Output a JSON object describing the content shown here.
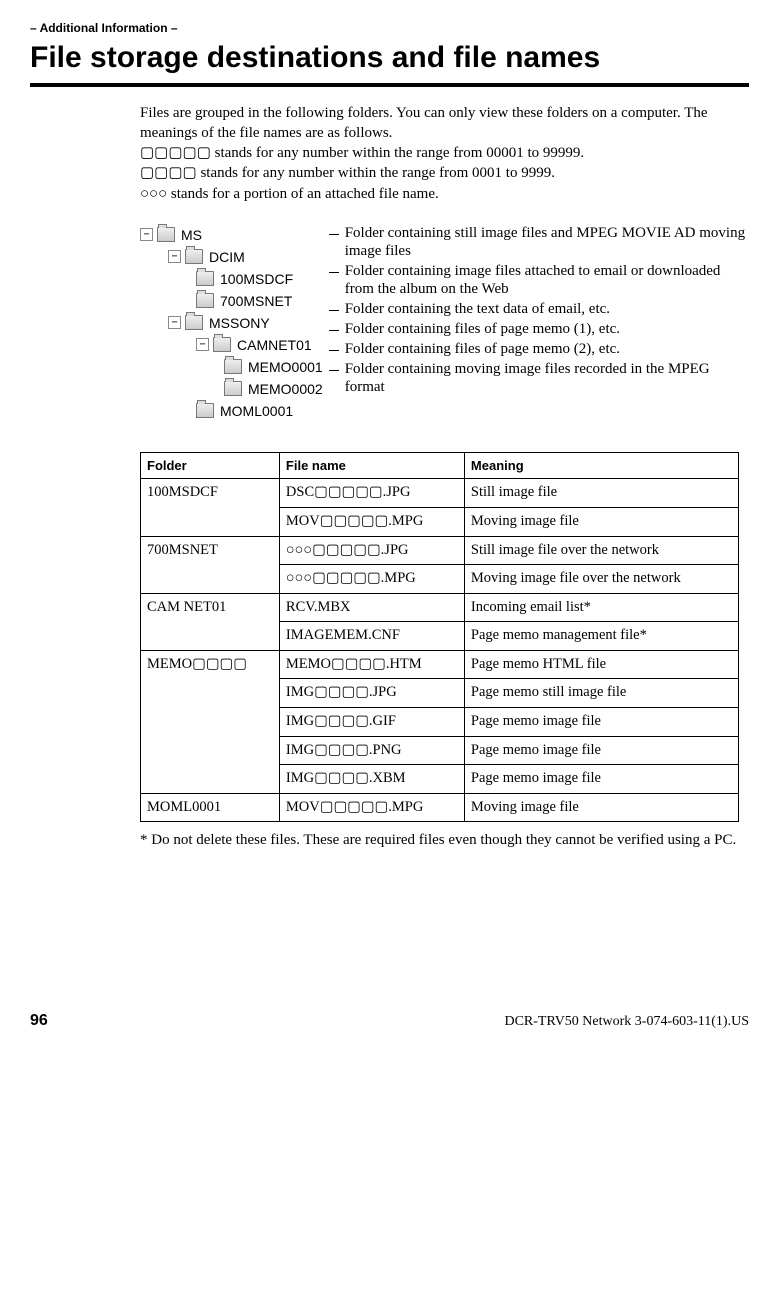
{
  "section_label": "– Additional Information –",
  "title": "File storage destinations and file names",
  "intro": {
    "l1": "Files are grouped in the following folders. You can only view these folders on a computer. The meanings of the file names are as follows.",
    "l2": "▢▢▢▢▢ stands for any number within the range from 00001 to 99999.",
    "l3": "▢▢▢▢ stands for any number within the range from 0001 to 9999.",
    "l4": "○○○ stands for a portion of an attached file name."
  },
  "tree": {
    "n0": "MS",
    "n1": "DCIM",
    "n2": "100MSDCF",
    "n3": "700MSNET",
    "n4": "MSSONY",
    "n5": "CAMNET01",
    "n6": "MEMO0001",
    "n7": "MEMO0002",
    "n8": "MOML0001"
  },
  "descs": {
    "d0": "Folder containing still image files and MPEG MOVIE AD moving image files",
    "d1": "Folder containing image files attached to email or downloaded from the album on the Web",
    "d2": "Folder containing the text data of email, etc.",
    "d3": "Folder containing files of page memo (1), etc.",
    "d4": "Folder containing files of page memo (2), etc.",
    "d5": "Folder containing moving image files recorded in the MPEG format"
  },
  "table": {
    "h0": "Folder",
    "h1": "File name",
    "h2": "Meaning",
    "rows": [
      {
        "folder": "100MSDCF",
        "file": "DSC▢▢▢▢▢.JPG",
        "meaning": "Still image file",
        "span": 2
      },
      {
        "folder": "",
        "file": "MOV▢▢▢▢▢.MPG",
        "meaning": "Moving image file"
      },
      {
        "folder": "700MSNET",
        "file": "○○○▢▢▢▢▢.JPG",
        "meaning": "Still image file over the network",
        "span": 2
      },
      {
        "folder": "",
        "file": "○○○▢▢▢▢▢.MPG",
        "meaning": "Moving image file over the network"
      },
      {
        "folder": "CAM NET01",
        "file": "RCV.MBX",
        "meaning": "Incoming email list*",
        "span": 2
      },
      {
        "folder": "",
        "file": "IMAGEMEM.CNF",
        "meaning": "Page memo management file*"
      },
      {
        "folder": "MEMO▢▢▢▢",
        "file": "MEMO▢▢▢▢.HTM",
        "meaning": "Page memo HTML file",
        "span": 5
      },
      {
        "folder": "",
        "file": "IMG▢▢▢▢.JPG",
        "meaning": "Page memo still image file"
      },
      {
        "folder": "",
        "file": "IMG▢▢▢▢.GIF",
        "meaning": "Page memo image file"
      },
      {
        "folder": "",
        "file": "IMG▢▢▢▢.PNG",
        "meaning": "Page memo image file"
      },
      {
        "folder": "",
        "file": "IMG▢▢▢▢.XBM",
        "meaning": "Page memo image file"
      },
      {
        "folder": "MOML0001",
        "file": "MOV▢▢▢▢▢.MPG",
        "meaning": "Moving image file",
        "span": 1
      }
    ]
  },
  "footnote": "* Do not delete these files. These are required files even though they cannot be verified using a PC.",
  "pagefoot": {
    "pn": "96",
    "doc": "DCR-TRV50 Network 3-074-603-11(1).US"
  }
}
